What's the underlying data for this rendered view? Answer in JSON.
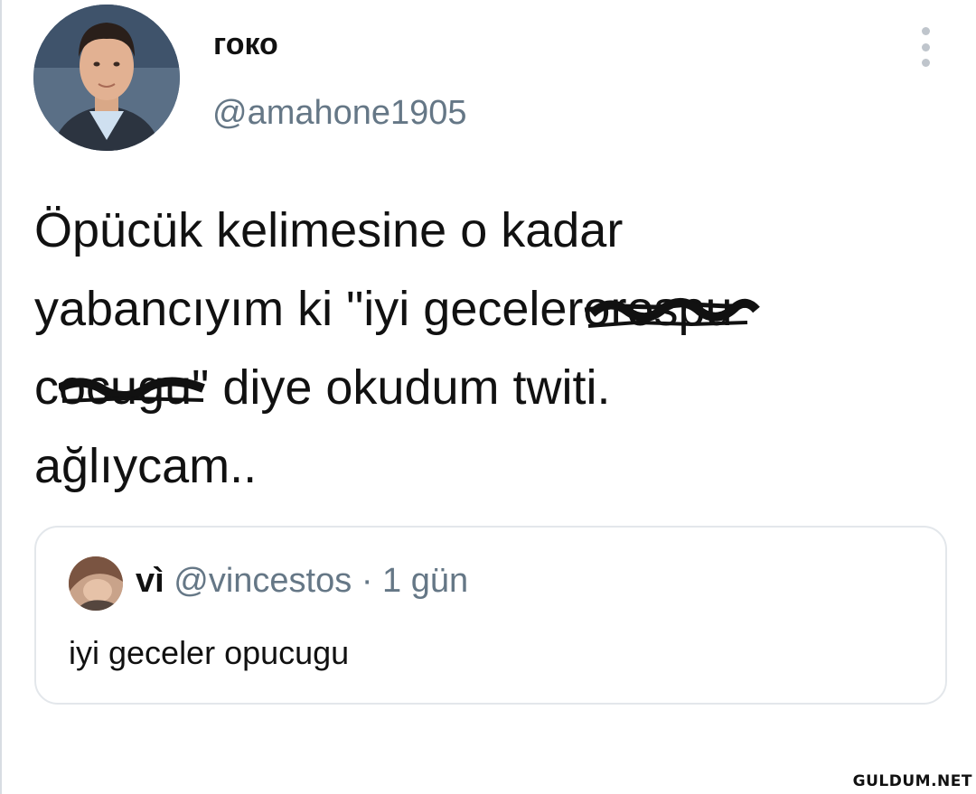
{
  "tweet": {
    "display_name": "гоко",
    "handle": "@amahone1905",
    "lines": {
      "l1": "Öpücük kelimesine o kadar",
      "l2a": "yabancıyım ki  \"iyi geceler",
      "l2b": "orospu",
      "l3a": "c",
      "l3b": "ocugu",
      "l3c": "\" diye okudum twiti.",
      "l4": "ağlıycam.."
    }
  },
  "quoted": {
    "name": "vì",
    "handle": "@vincestos",
    "separator": "·",
    "time": "1 gün",
    "text": "iyi geceler opucugu"
  },
  "watermark": "GULDUM.NET",
  "colors": {
    "text": "#111111",
    "secondary": "#657786",
    "border": "#e3e7eb"
  }
}
